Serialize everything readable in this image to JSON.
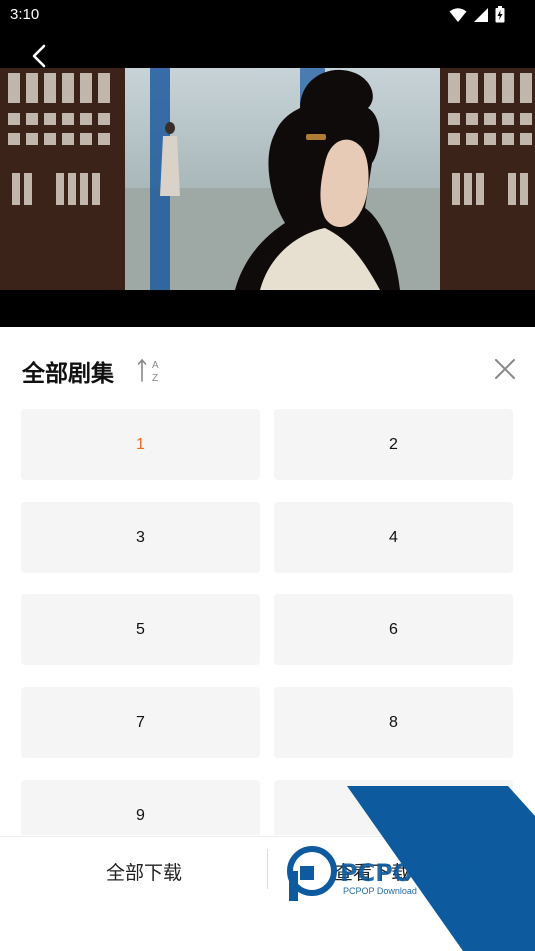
{
  "status_bar": {
    "time": "3:10"
  },
  "panel": {
    "title": "全部剧集",
    "sort_icon_text": {
      "top": "A",
      "bottom": "Z"
    }
  },
  "episodes": [
    {
      "label": "1",
      "active": true
    },
    {
      "label": "2",
      "active": false
    },
    {
      "label": "3",
      "active": false
    },
    {
      "label": "4",
      "active": false
    },
    {
      "label": "5",
      "active": false
    },
    {
      "label": "6",
      "active": false
    },
    {
      "label": "7",
      "active": false
    },
    {
      "label": "8",
      "active": false
    },
    {
      "label": "9",
      "active": false
    },
    {
      "label": "",
      "active": false
    }
  ],
  "bottom_bar": {
    "download_all": "全部下载",
    "view_downloads": "查看下载"
  },
  "watermark": {
    "brand": "PCPOP下载",
    "sub": "PCPOP Download"
  },
  "colors": {
    "active_episode": "#f06a1e",
    "watermark_blue": "#0d5a9e"
  }
}
